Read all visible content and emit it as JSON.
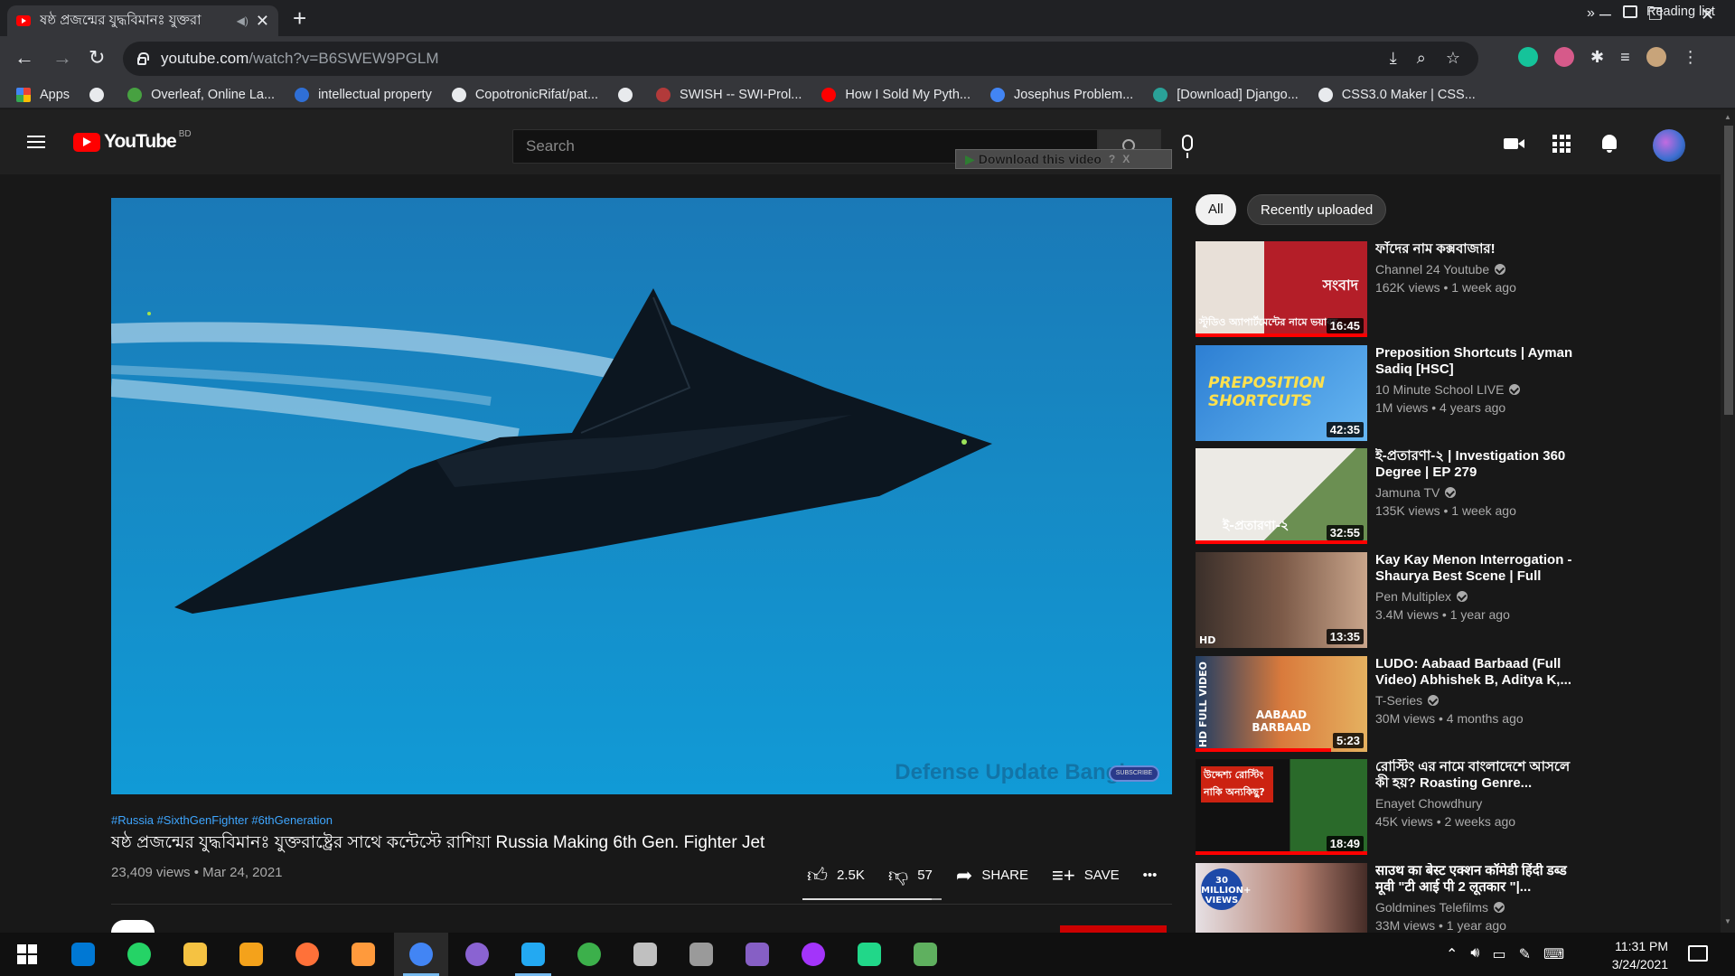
{
  "browser": {
    "tab": {
      "title": "ষষ্ঠ প্রজন্মের যুদ্ধবিমানঃ যুক্তরা"
    },
    "url": {
      "host": "youtube.com",
      "path": "/watch?v=B6SWEW9PGLM"
    },
    "bookmarks": [
      {
        "label": "Apps",
        "color": "#ea4335"
      },
      {
        "label": "",
        "color": "#e8eaed"
      },
      {
        "label": "Overleaf, Online La...",
        "color": "#47a141"
      },
      {
        "label": "intellectual property",
        "color": "#2f6fd6"
      },
      {
        "label": "CopotronicRifat/pat...",
        "color": "#e8eaed"
      },
      {
        "label": "",
        "color": "#e8eaed"
      },
      {
        "label": "SWISH -- SWI-Prol...",
        "color": "#b23a3a"
      },
      {
        "label": "How I Sold My Pyth...",
        "color": "#ff0000"
      },
      {
        "label": "Josephus Problem...",
        "color": "#4285f4"
      },
      {
        "label": "[Download] Django...",
        "color": "#2aa198"
      },
      {
        "label": "CSS3.0 Maker | CSS...",
        "color": "#e8eaed"
      }
    ],
    "bookmarks_more": "»",
    "reading_list": "Reading list"
  },
  "youtube": {
    "logo_text": "YouTube",
    "country_code": "BD",
    "search_placeholder": "Search",
    "download_bar": "Download this video",
    "download_help": "?",
    "download_close": "X"
  },
  "video": {
    "watermark": "Defense Update Bangl",
    "subscribe_badge": "SUBSCRIBE",
    "hashtags": "#Russia #SixthGenFighter #6thGeneration",
    "title": "ষষ্ঠ প্রজন্মের যুদ্ধবিমানঃ যুক্তরাষ্ট্রের সাথে কন্টেস্টে রাশিয়া Russia Making 6th Gen. Fighter Jet",
    "meta": "23,409 views • Mar 24, 2021",
    "likes": "2.5K",
    "dislikes": "57",
    "share": "SHARE",
    "save": "SAVE",
    "more": "•••"
  },
  "chips": {
    "all": "All",
    "recent": "Recently uploaded"
  },
  "recommendations": [
    {
      "title": "ফাঁদের নাম কক্সবাজার!",
      "channel": "Channel 24 Youtube",
      "verified": true,
      "meta": "162K views • 1 week ago",
      "duration": "16:45",
      "thumb_text": "স্টুডিও অ্যাপার্টমেন্টের নামে ভয়াবহ",
      "thumb_brand": "সংবাদ"
    },
    {
      "title": "Preposition Shortcuts | Ayman Sadiq [HSC]",
      "channel": "10 Minute School LIVE",
      "verified": true,
      "meta": "1M views • 4 years ago",
      "duration": "42:35",
      "thumb_text": "PREPOSITION SHORTCUTS"
    },
    {
      "title": "ই-প্রতারণা-২ | Investigation 360 Degree | EP 279",
      "channel": "Jamuna TV",
      "verified": true,
      "meta": "135K views • 1 week ago",
      "duration": "32:55",
      "thumb_text": "ই-প্রতারণা-২"
    },
    {
      "title": "Kay Kay Menon Interrogation - Shaurya Best Scene | Full Hind...",
      "channel": "Pen Multiplex",
      "verified": true,
      "meta": "3.4M views • 1 year ago",
      "duration": "13:35",
      "thumb_text": "HD"
    },
    {
      "title": "LUDO: Aabaad Barbaad (Full Video) Abhishek B, Aditya K,...",
      "channel": "T-Series",
      "verified": true,
      "meta": "30M views • 4 months ago",
      "duration": "5:23",
      "thumb_text": "HD FULL VIDEO",
      "thumb_brand": "AABAAD BARBAAD"
    },
    {
      "title": "রোস্টিং এর নামে বাংলাদেশে আসলে কী হয়? Roasting Genre...",
      "channel": "Enayet Chowdhury",
      "verified": false,
      "meta": "45K views • 2 weeks ago",
      "duration": "18:49",
      "thumb_text": "উদ্দেশ্য রোস্টিং নাকি অন্যকিছু?"
    },
    {
      "title": "साउथ का बेस्ट एक्शन कॉमेडी हिंदी डब्ड मूवी \"टी आई पी 2 लूतकार \"|...",
      "channel": "Goldmines Telefilms",
      "verified": true,
      "meta": "33M views • 1 year ago",
      "duration": "",
      "thumb_text": "30 MILLION+ VIEWS"
    }
  ],
  "taskbar": {
    "time": "11:31 PM",
    "date": "3/24/2021",
    "apps": [
      {
        "name": "windows-start",
        "color": "#ffffff"
      },
      {
        "name": "search",
        "color": "#0078d4"
      },
      {
        "name": "whatsapp",
        "color": "#25d366"
      },
      {
        "name": "file-explorer",
        "color": "#f5c242"
      },
      {
        "name": "browser-1",
        "color": "#f4a21b"
      },
      {
        "name": "firefox",
        "color": "#ff7139"
      },
      {
        "name": "sublime",
        "color": "#ff9a3c"
      },
      {
        "name": "chrome",
        "color": "#4285f4"
      },
      {
        "name": "github-desktop",
        "color": "#8a63d2"
      },
      {
        "name": "vscode",
        "color": "#23a9f2"
      },
      {
        "name": "globe-app",
        "color": "#3cb04b"
      },
      {
        "name": "parachute-app",
        "color": "#c0c0c0"
      },
      {
        "name": "satellite-app",
        "color": "#9a9a9a"
      },
      {
        "name": "visual-studio",
        "color": "#865fc5"
      },
      {
        "name": "messenger",
        "color": "#a334fa"
      },
      {
        "name": "pycharm",
        "color": "#21d789"
      },
      {
        "name": "notepad-app",
        "color": "#5fb05f"
      }
    ]
  },
  "colors": {
    "accent": "#ff0000",
    "link": "#3ea6ff",
    "bg": "#181818"
  }
}
